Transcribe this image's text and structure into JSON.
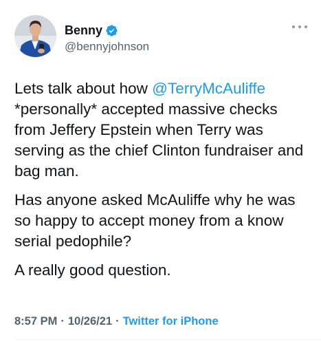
{
  "author": {
    "display_name": "Benny",
    "handle": "@bennyjohnson",
    "verified": true
  },
  "tweet": {
    "p1_before": "Lets talk about how ",
    "p1_mention": "@TerryMcAuliffe",
    "p1_after": " *personally* accepted massive checks from Jeffery Epstein when Terry was serving as the chief Clinton fundraiser and bag man.",
    "p2": "Has anyone asked McAuliffe why he was so happy to accept money from a know serial pedophile?",
    "p3": "A really good question."
  },
  "meta": {
    "time": "8:57 PM",
    "sep1": "·",
    "date": "10/26/21",
    "sep2": "·",
    "source": "Twitter for iPhone"
  },
  "colors": {
    "accent": "#1d9bf0",
    "muted": "#536471",
    "text": "#0f1419"
  },
  "icons": {
    "verified": "verified-badge-icon",
    "more": "more-options-icon"
  }
}
